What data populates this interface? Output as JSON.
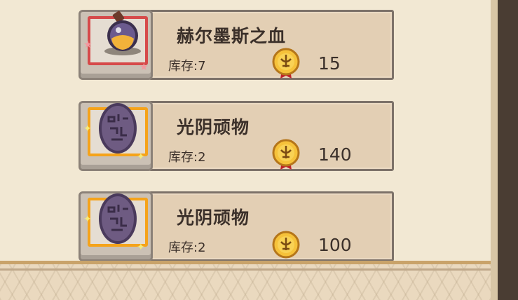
{
  "shop": {
    "items": [
      {
        "name": "赫尔墨斯之血",
        "stock": "库存:7",
        "price": "15",
        "icon": "potion-flask-icon",
        "rarity_color": "#d64a4a"
      },
      {
        "name": "光阴顽物",
        "stock": "库存:2",
        "price": "140",
        "icon": "rune-egg-icon",
        "rarity_color": "#f5a31a"
      },
      {
        "name": "光阴顽物",
        "stock": "库存:2",
        "price": "100",
        "icon": "rune-egg-icon",
        "rarity_color": "#f5a31a"
      }
    ],
    "currency_icon": "gold-medal-coin-icon"
  }
}
